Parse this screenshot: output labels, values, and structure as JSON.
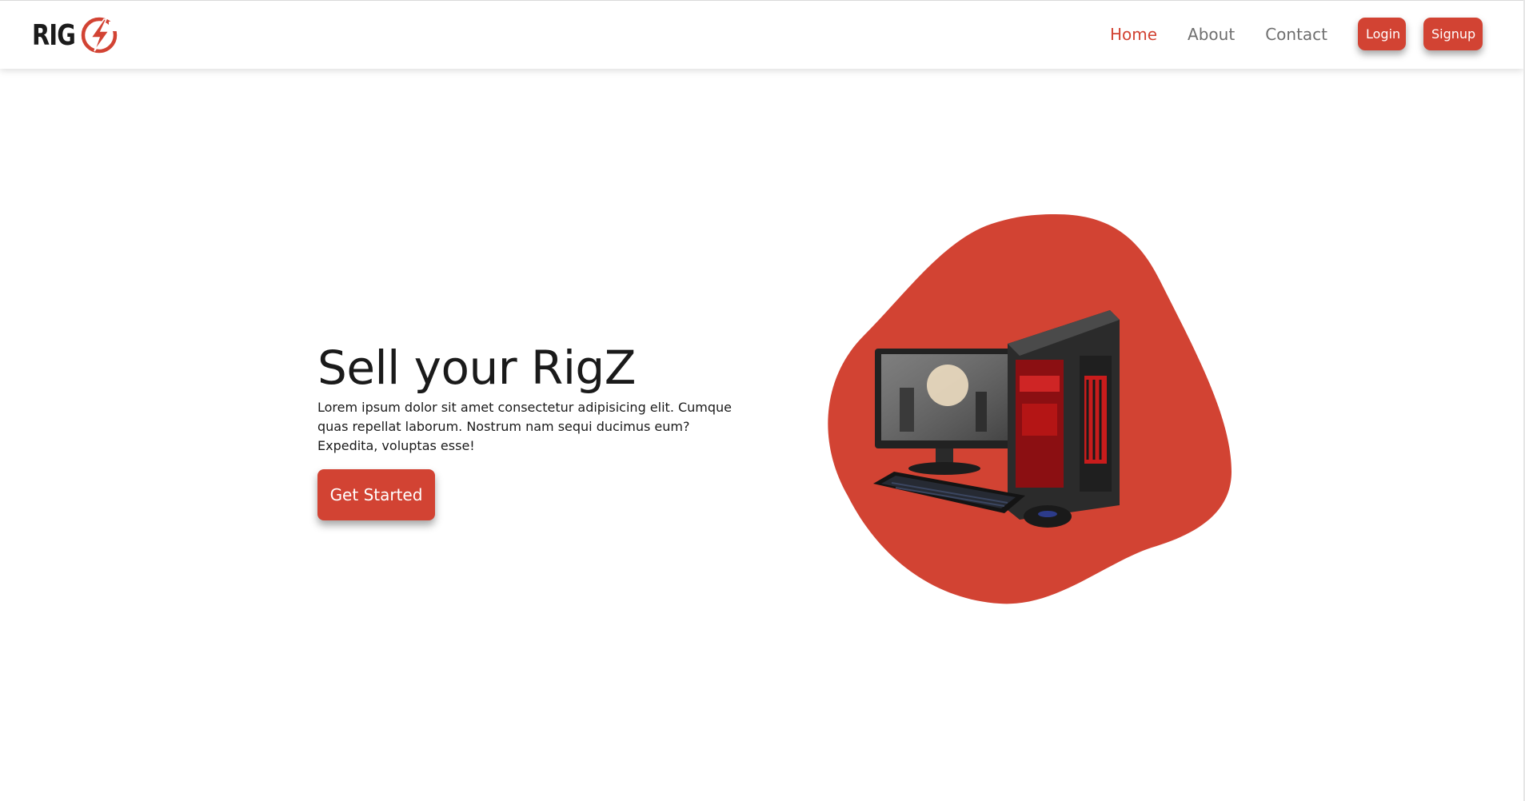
{
  "brand": {
    "logo_text": "RIG",
    "accent_color": "#d24333"
  },
  "nav": {
    "links": [
      {
        "label": "Home",
        "active": true
      },
      {
        "label": "About",
        "active": false
      },
      {
        "label": "Contact",
        "active": false
      }
    ],
    "login_label": "Login",
    "signup_label": "Signup"
  },
  "hero": {
    "title": "Sell your RigZ",
    "description": "Lorem ipsum dolor sit amet consectetur adipisicing elit. Cumque quas repellat laborum. Nostrum nam sequi ducimus eum? Expedita, voluptas esse!",
    "cta_label": "Get Started",
    "image_subject": "gaming-pc-with-monitor-keyboard-mouse"
  }
}
